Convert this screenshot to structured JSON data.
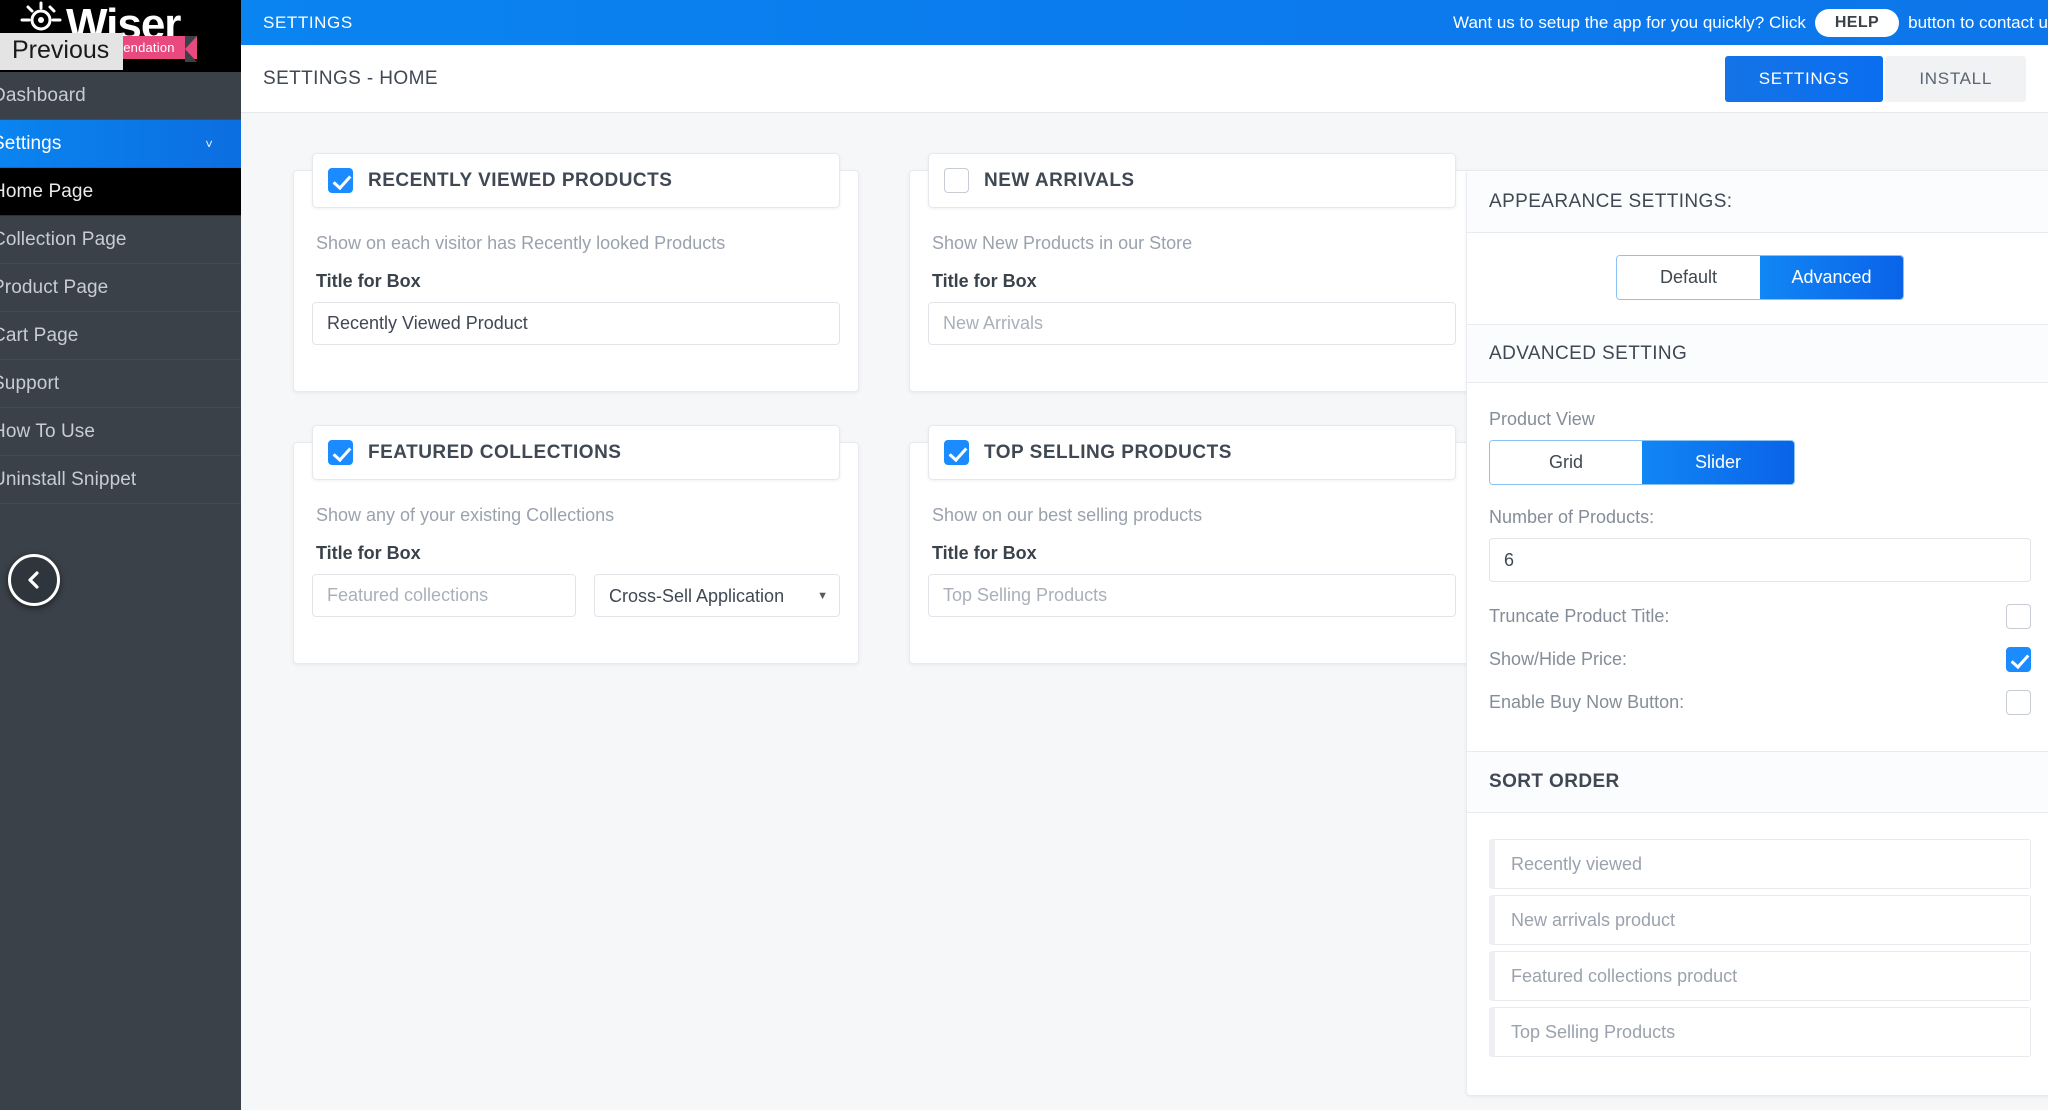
{
  "brand": {
    "name": "Wiser",
    "ribbon": "Recommendation",
    "tooltip": "Previous",
    "sun_icon": "sun-icon"
  },
  "sidebar": {
    "collapse_icon": "chevron-left-icon",
    "items": [
      {
        "label": "Dashboard",
        "state": "normal"
      },
      {
        "label": "Settings",
        "state": "active",
        "chevron": "˅"
      },
      {
        "label": "Home Page",
        "state": "sub-active"
      },
      {
        "label": "Collection Page",
        "state": "normal"
      },
      {
        "label": "Product Page",
        "state": "normal"
      },
      {
        "label": "Cart Page",
        "state": "normal"
      },
      {
        "label": "Support",
        "state": "normal"
      },
      {
        "label": "How To Use",
        "state": "normal"
      },
      {
        "label": "Uninstall Snippet",
        "state": "normal"
      }
    ]
  },
  "topbar": {
    "title": "SETTINGS",
    "notice_before": "Want us to setup the app for you quickly? Click",
    "help_label": "HELP",
    "notice_after": "button to contact u"
  },
  "subheader": {
    "breadcrumb": "SETTINGS - HOME",
    "tabs": [
      {
        "label": "SETTINGS",
        "active": true
      },
      {
        "label": "INSTALL",
        "active": false
      }
    ]
  },
  "cards": [
    {
      "title": "RECENTLY VIEWED PRODUCTS",
      "checked": true,
      "description": "Show on each visitor has Recently looked Products",
      "field_label": "Title for Box",
      "input_value": "Recently Viewed Product",
      "input_placeholder": "Recently Viewed Product",
      "has_select": false
    },
    {
      "title": "NEW ARRIVALS",
      "checked": false,
      "description": "Show New Products in our Store",
      "field_label": "Title for Box",
      "input_value": "",
      "input_placeholder": "New Arrivals",
      "has_select": false
    },
    {
      "title": "FEATURED COLLECTIONS",
      "checked": true,
      "description": "Show any of your existing Collections",
      "field_label": "Title for Box",
      "input_value": "",
      "input_placeholder": "Featured collections",
      "has_select": true,
      "select_value": "Cross-Sell Application",
      "select_options": [
        "Cross-Sell Application"
      ]
    },
    {
      "title": "TOP SELLING PRODUCTS",
      "checked": true,
      "description": "Show on our best selling products",
      "field_label": "Title for Box",
      "input_value": "",
      "input_placeholder": "Top Selling Products",
      "has_select": false
    }
  ],
  "panel": {
    "appearance_title": "APPEARANCE SETTINGS:",
    "mode_toggle": {
      "default_label": "Default",
      "advanced_label": "Advanced",
      "selected": "Advanced"
    },
    "advanced_title": "ADVANCED SETTING",
    "product_view_label": "Product View",
    "product_view": {
      "grid_label": "Grid",
      "slider_label": "Slider",
      "selected": "Slider"
    },
    "number_label": "Number of Products:",
    "number_value": "6",
    "options": [
      {
        "label": "Truncate Product Title:",
        "checked": false
      },
      {
        "label": "Show/Hide Price:",
        "checked": true
      },
      {
        "label": "Enable Buy Now Button:",
        "checked": false
      }
    ],
    "sort_order_title": "SORT ORDER",
    "sort_items": [
      "Recently viewed",
      "New arrivals product",
      "Featured collections product",
      "Top Selling Products"
    ]
  },
  "colors": {
    "accent": "#0a7cf0",
    "sidebar": "#3a4149",
    "ribbon": "#e8497e",
    "checkbox_on": "#1a8cff",
    "content_bg": "#f6f7f9"
  }
}
